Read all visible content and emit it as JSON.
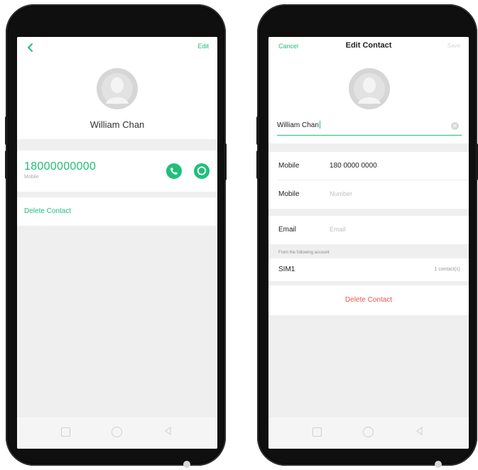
{
  "colors": {
    "accent": "#1fbf7a",
    "danger": "#f0554a",
    "frame": "#0f0f0f",
    "screen_bg": "#efefef"
  },
  "left_screen": {
    "header": {
      "back_icon": "chevron-left-icon",
      "edit_label": "Edit"
    },
    "contact": {
      "avatar_icon": "person-silhouette-icon",
      "name": "William Chan"
    },
    "phone_entry": {
      "number": "18000000000",
      "type": "Mobile",
      "call_icon": "phone-icon",
      "message_icon": "message-bubble-icon"
    },
    "delete_label": "Delete Contact",
    "nav": [
      "square-icon",
      "circle-icon",
      "back-triangle-icon"
    ]
  },
  "right_screen": {
    "header": {
      "cancel_label": "Cancel",
      "title": "Edit Contact",
      "save_label": "Save"
    },
    "contact": {
      "avatar_icon": "person-silhouette-icon",
      "name_value": "William Chan",
      "clear_icon": "clear-x-icon"
    },
    "fields": [
      {
        "label": "Mobile",
        "value": "180 0000 0000",
        "placeholder": ""
      },
      {
        "label": "Mobile",
        "value": "",
        "placeholder": "Number"
      }
    ],
    "email": {
      "label": "Email",
      "placeholder": "Email"
    },
    "account": {
      "caption": "From the following account",
      "name": "SIM1",
      "count": "1 contact(s)"
    },
    "delete_label": "Delete Contact",
    "nav": [
      "square-icon",
      "circle-icon",
      "back-triangle-icon"
    ]
  }
}
